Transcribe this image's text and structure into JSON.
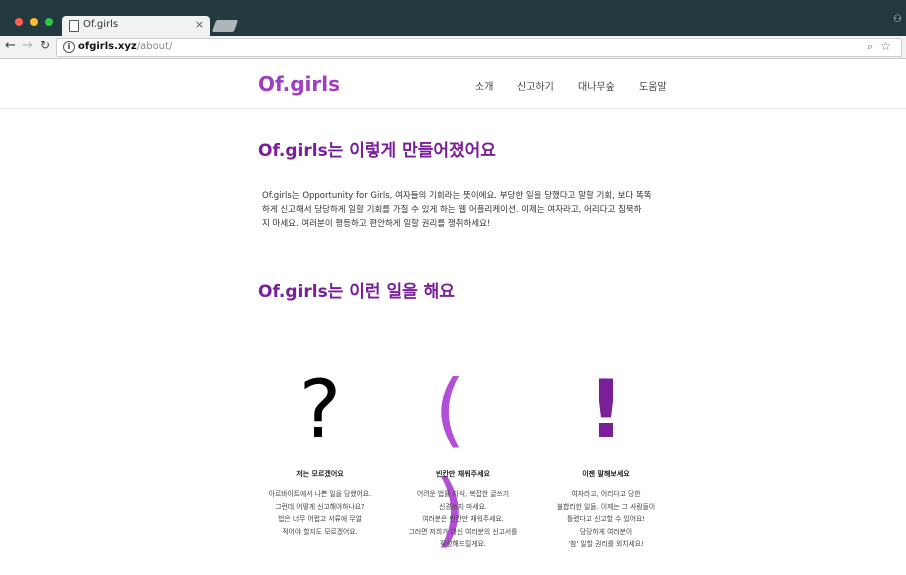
{
  "browser": {
    "tab_title": "Of.girls",
    "url_host": "ofgirls.xyz",
    "url_path": "/about/"
  },
  "site": {
    "logo": "Of.girls",
    "nav": [
      "소개",
      "신고하기",
      "대나무숲",
      "도움말"
    ]
  },
  "about": {
    "heading": "Of.girls는 이렇게 만들어졌어요",
    "intro": [
      "Of.girls는 Opportunity for Girls, 여자들의 기회라는 뜻이에요. 부당한 일을 당했다고 말할 기회, 보다 똑똑",
      "하게 신고해서 당당하게 일할 기회를 가질 수 있게 하는 웹 어플리케이션. 이제는 여자라고, 어리다고 침묵하",
      "지 마세요. 여러분이 평등하고 편안하게 일할 권리를 쟁취하세요!"
    ],
    "heading2": "Of.girls는 이런 일을 해요"
  },
  "features": [
    {
      "icon": "question-mark-icon",
      "glyph": "?",
      "title": "저는 모르겠어요",
      "lines": [
        "아르바이트에서 나쁜 일을 당했어요.",
        "그런데 어떻게 신고해야하나요?",
        "법은 너무 어렵고 서류에 무얼",
        "적어야 할지도 모르겠어요."
      ]
    },
    {
      "icon": "parentheses-icon",
      "glyph": "( )",
      "title": "빈칸만 채워주세요",
      "lines": [
        "어려운 법률 지식, 복잡한 글쓰기",
        "신경쓰지 마세요.",
        "여러분은 빈칸만 채워주세요.",
        "그러면 저희가 대신 여러분의 신고서를",
        "작성해드릴게요."
      ]
    },
    {
      "icon": "exclamation-mark-icon",
      "glyph": "!",
      "title": "이젠 말해보세요",
      "lines": [
        "여자라고, 어리다고 당한",
        "불합리한 일들. 이제는 그 사람들이",
        "틀렸다고 신고할 수 있어요!",
        "당당하게 여러분이",
        "'참' 일할 권리를 외치세요!"
      ]
    }
  ]
}
